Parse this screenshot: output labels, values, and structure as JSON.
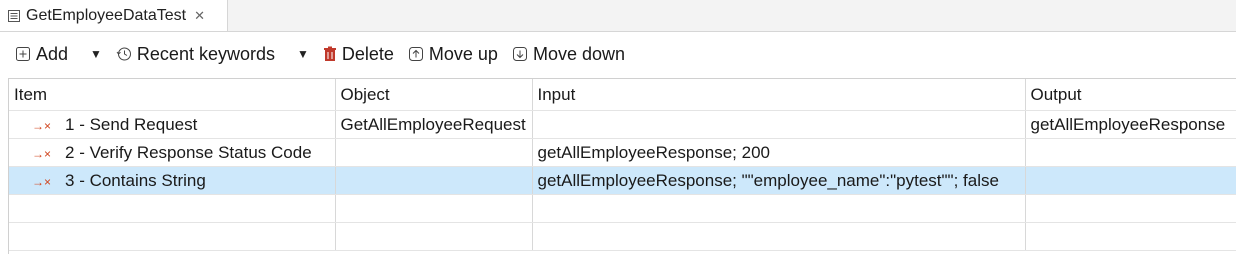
{
  "tab": {
    "title": "GetEmployeeDataTest",
    "close": "✕"
  },
  "toolbar": {
    "add": "Add",
    "recent": "Recent keywords",
    "delete": "Delete",
    "move_up": "Move up",
    "move_down": "Move down"
  },
  "table": {
    "headers": [
      "Item",
      "Object",
      "Input",
      "Output"
    ],
    "rows": [
      {
        "item": "1 - Send Request",
        "object": "GetAllEmployeeRequest",
        "input": "",
        "output": "getAllEmployeeResponse"
      },
      {
        "item": "2 - Verify Response Status Code",
        "object": "",
        "input": "getAllEmployeeResponse; 200",
        "output": ""
      },
      {
        "item": "3 - Contains String",
        "object": "",
        "input": "getAllEmployeeResponse; \"\"employee_name\":\"pytest\"\"; false",
        "output": ""
      }
    ]
  },
  "colors": {
    "selected_row": "#cde8fb",
    "step_icon": "#d0421b"
  }
}
